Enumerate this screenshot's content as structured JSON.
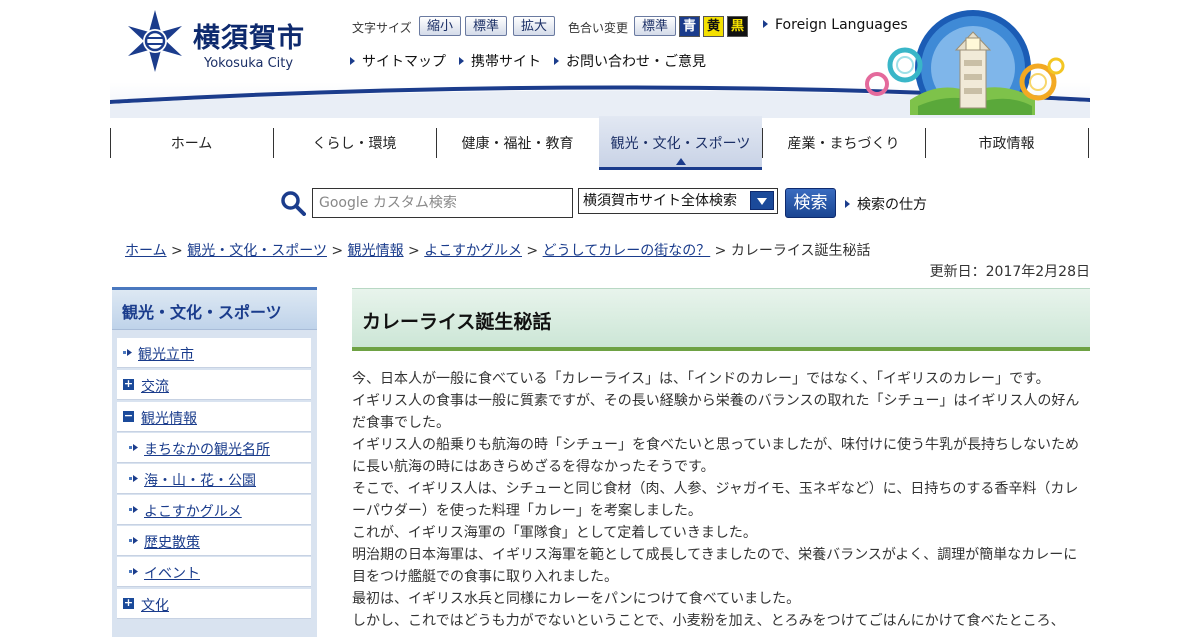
{
  "logo": {
    "name_ja": "横須賀市",
    "name_en": "Yokosuka City"
  },
  "utility": {
    "font_size_label": "文字サイズ",
    "font_size_buttons": [
      "縮小",
      "標準",
      "拡大"
    ],
    "color_label": "色合い変更",
    "color_standard": "標準",
    "color_options": [
      {
        "label": "青",
        "bg": "#1b3c8c",
        "fg": "#ffffff"
      },
      {
        "label": "黄",
        "bg": "#f4e000",
        "fg": "#111111"
      },
      {
        "label": "黒",
        "bg": "#111111",
        "fg": "#f4e000"
      }
    ],
    "foreign_languages": "Foreign Languages",
    "sitemap": "サイトマップ",
    "mobile": "携帯サイト",
    "contact": "お問い合わせ・ご意見"
  },
  "nav": {
    "items": [
      "ホーム",
      "くらし・環境",
      "健康・福祉・教育",
      "観光・文化・スポーツ",
      "産業・まちづくり",
      "市政情報"
    ],
    "active": "観光・文化・スポーツ"
  },
  "search": {
    "placeholder": "Google カスタム検索",
    "scope": "横須賀市サイト全体検索",
    "button": "検索",
    "help": "検索の仕方"
  },
  "breadcrumb": {
    "items": [
      "ホーム",
      "観光・文化・スポーツ",
      "観光情報",
      "よこすかグルメ",
      "どうしてカレーの街なの？"
    ],
    "current": "カレーライス誕生秘話",
    "separator": " > "
  },
  "updated": "更新日：2017年2月28日",
  "sidebar": {
    "title": "観光・文化・スポーツ",
    "items": [
      {
        "label": "観光立市",
        "type": "arrow",
        "level": 0
      },
      {
        "label": "交流",
        "type": "plus",
        "level": 0
      },
      {
        "label": "観光情報",
        "type": "minus",
        "level": 0
      },
      {
        "label": "まちなかの観光名所",
        "type": "arrow",
        "level": 1
      },
      {
        "label": "海・山・花・公園",
        "type": "arrow",
        "level": 1
      },
      {
        "label": "よこすかグルメ",
        "type": "arrow",
        "level": 1
      },
      {
        "label": "歴史散策",
        "type": "arrow",
        "level": 1
      },
      {
        "label": "イベント",
        "type": "arrow",
        "level": 1
      },
      {
        "label": "文化",
        "type": "plus",
        "level": 0
      }
    ]
  },
  "article": {
    "title": "カレーライス誕生秘話",
    "paragraphs": [
      "今、日本人が一般に食べている「カレーライス」は、「インドのカレー」ではなく、「イギリスのカレー」です。",
      "イギリス人の食事は一般に質素ですが、その長い経験から栄養のバランスの取れた「シチュー」はイギリス人の好んだ食事でした。",
      "イギリス人の船乗りも航海の時「シチュー」を食べたいと思っていましたが、味付けに使う牛乳が長持ちしないために長い航海の時にはあきらめざるを得なかったそうです。",
      "そこで、イギリス人は、シチューと同じ食材（肉、人参、ジャガイモ、玉ネギなど）に、日持ちのする香辛料（カレーパウダー）を使った料理「カレー」を考案しました。",
      "これが、イギリス海軍の「軍隊食」として定着していきました。",
      "明治期の日本海軍は、イギリス海軍を範として成長してきましたので、栄養バランスがよく、調理が簡単なカレーに目をつけ艦艇での食事に取り入れました。",
      "最初は、イギリス水兵と同様にカレーをパンにつけて食べていました。",
      "しかし、これではどうも力がでないということで、小麦粉を加え、とろみをつけてごはんにかけて食べたところ、"
    ]
  }
}
